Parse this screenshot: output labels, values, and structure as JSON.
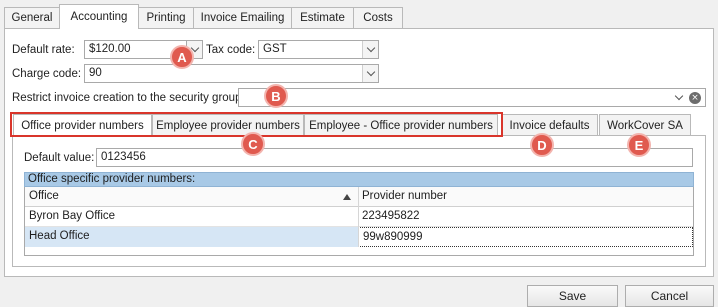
{
  "top_tabs": [
    {
      "label": "General"
    },
    {
      "label": "Accounting"
    },
    {
      "label": "Printing"
    },
    {
      "label": "Invoice Emailing"
    },
    {
      "label": "Estimate"
    },
    {
      "label": "Costs"
    }
  ],
  "form": {
    "default_rate_label": "Default rate:",
    "default_rate_value": "$120.00",
    "tax_code_label": "Tax code:",
    "tax_code_value": "GST",
    "charge_code_label": "Charge code:",
    "charge_code_value": "90",
    "restrict_label": "Restrict invoice creation to the security group:",
    "restrict_value": ""
  },
  "callouts": {
    "a": "A",
    "b": "B",
    "c": "C",
    "d": "D",
    "e": "E"
  },
  "inner_tabs": [
    {
      "label": "Office provider numbers"
    },
    {
      "label": "Employee provider numbers"
    },
    {
      "label": "Employee - Office provider numbers"
    },
    {
      "label": "Invoice defaults"
    },
    {
      "label": "WorkCover SA"
    }
  ],
  "provider": {
    "default_value_label": "Default value:",
    "default_value": "0123456",
    "group_header": "Office specific provider numbers:",
    "columns": [
      "Office",
      "Provider number"
    ],
    "rows": [
      {
        "office": "Byron Bay Office",
        "number": "223495822"
      },
      {
        "office": "Head Office",
        "number": "99w890999"
      }
    ]
  },
  "buttons": {
    "save": "Save",
    "cancel": "Cancel"
  },
  "colors": {
    "callout": "#e05a4f",
    "highlight_border": "#d9352b",
    "selected_row": "#d6e6f5",
    "group_header": "#a8c9e6"
  }
}
